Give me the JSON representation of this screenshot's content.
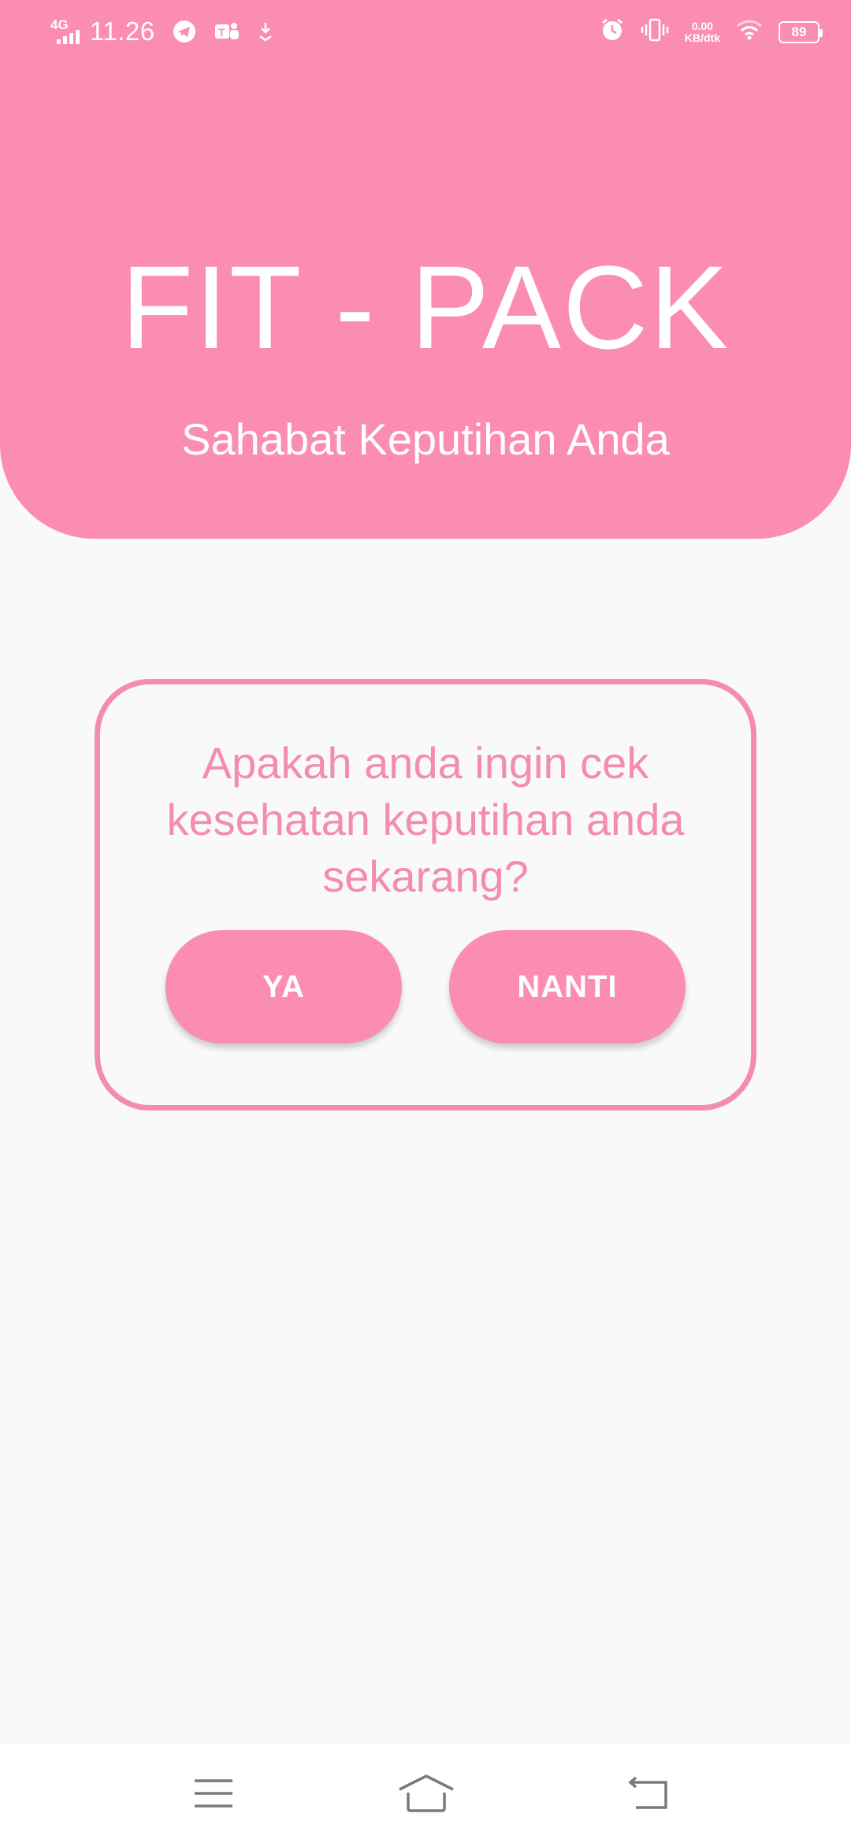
{
  "status_bar": {
    "network": "4G",
    "time": "11.26",
    "speed_value": "0.00",
    "speed_unit": "KB/dtk",
    "battery": "89",
    "icons": [
      "telegram-icon",
      "teams-icon",
      "download-icon",
      "alarm-icon",
      "vibrate-icon",
      "wifi-icon",
      "battery-icon"
    ]
  },
  "header": {
    "title": "FIT - PACK",
    "subtitle": "Sahabat Keputihan Anda"
  },
  "dialog": {
    "question": "Apakah anda ingin cek kesehatan keputihan anda sekarang?",
    "yes_label": "YA",
    "later_label": "NANTI"
  },
  "nav_bar": {
    "icons": [
      "menu-icon",
      "home-icon",
      "back-icon"
    ]
  },
  "colors": {
    "primary_pink": "#fa8db0",
    "text_pink": "#f38cb0",
    "background": "#f9f9f9",
    "white": "#ffffff"
  }
}
